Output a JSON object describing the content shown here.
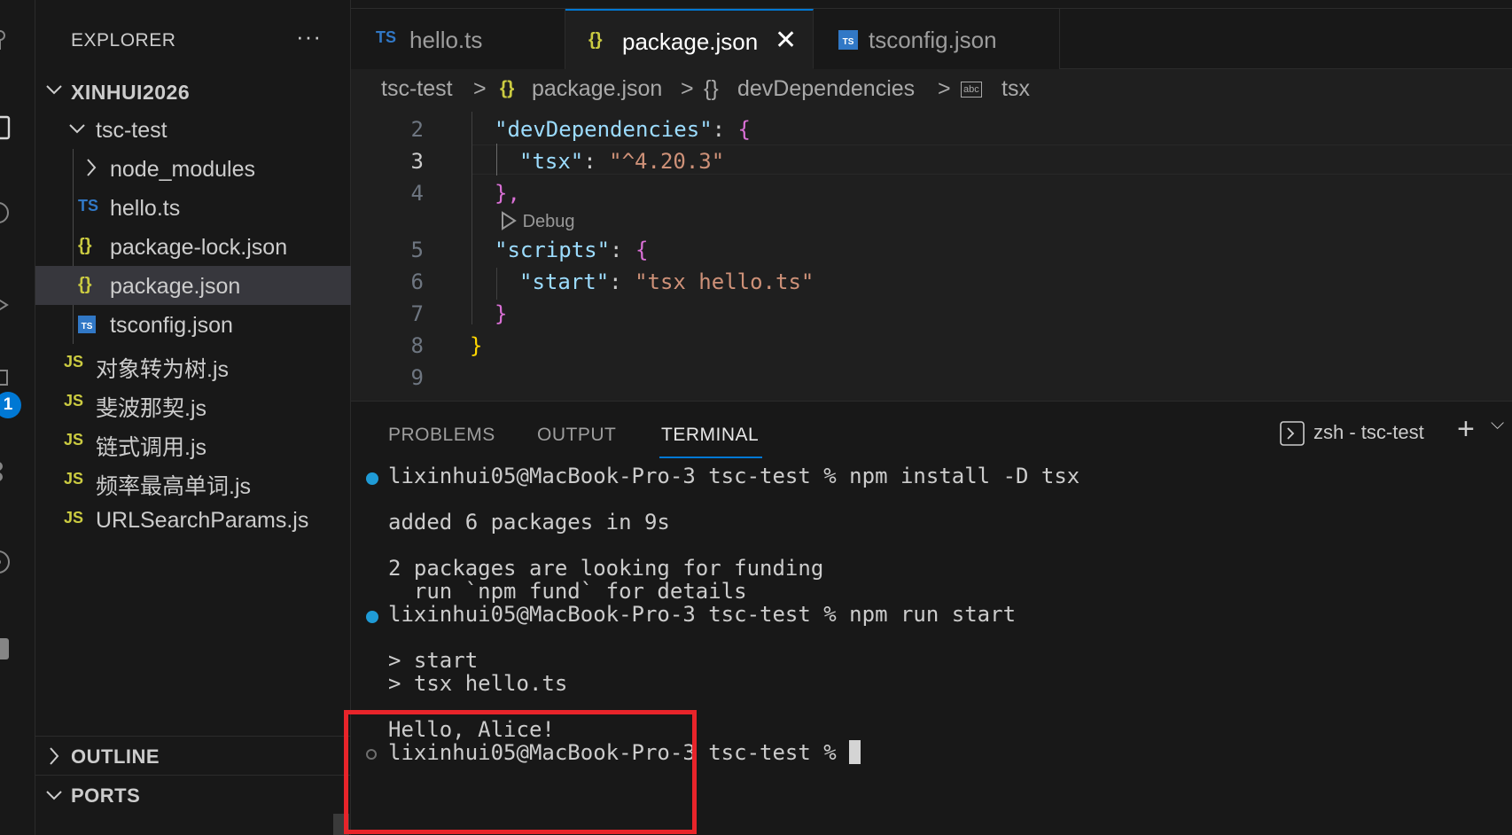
{
  "sidebar": {
    "header": "EXPLORER",
    "more": "···",
    "root": "XINHUI2026",
    "folder": "tsc-test",
    "items": [
      {
        "icon": "›",
        "label": "node_modules",
        "type": "folder"
      },
      {
        "icon": "TS",
        "label": "hello.ts",
        "type": "ts"
      },
      {
        "icon": "{}",
        "label": "package-lock.json",
        "type": "json"
      },
      {
        "icon": "{}",
        "label": "package.json",
        "type": "json"
      },
      {
        "icon": "TS",
        "label": "tsconfig.json",
        "type": "tsconfig"
      }
    ],
    "root_files": [
      {
        "icon": "JS",
        "label": "对象转为树.js"
      },
      {
        "icon": "JS",
        "label": "斐波那契.js"
      },
      {
        "icon": "JS",
        "label": "链式调用.js"
      },
      {
        "icon": "JS",
        "label": "频率最高单词.js"
      },
      {
        "icon": "JS",
        "label": "URLSearchParams.js"
      }
    ],
    "outline": "OUTLINE",
    "ports": "PORTS"
  },
  "activity_badge": "1",
  "tabs": [
    {
      "icon": "TS",
      "label": "hello.ts"
    },
    {
      "icon": "{}",
      "label": "package.json",
      "close": "✕"
    },
    {
      "icon": "TS",
      "label": "tsconfig.json"
    }
  ],
  "breadcrumb": {
    "folder": "tsc-test",
    "file_icon": "{}",
    "file": "package.json",
    "sep": ">",
    "obj_icon": "{}",
    "obj": "devDependencies",
    "leaf_icon": "abc",
    "leaf": "tsx"
  },
  "code": {
    "line_numbers": [
      "2",
      "3",
      "4",
      "5",
      "6",
      "7",
      "8",
      "9"
    ],
    "key_devdeps": "\"devDependencies\"",
    "key_tsx": "\"tsx\"",
    "val_tsx": "\"^4.20.3\"",
    "codelens": "Debug",
    "key_scripts": "\"scripts\"",
    "key_start": "\"start\"",
    "val_start": "\"tsx hello.ts\"",
    "colon": ": ",
    "open_brace": "{",
    "close_brace_comma": "},",
    "close_brace": "}"
  },
  "panel": {
    "tabs": [
      "PROBLEMS",
      "OUTPUT",
      "TERMINAL"
    ],
    "shell": "zsh - tsc-test",
    "add": "+",
    "chevron": "⌵"
  },
  "terminal": {
    "lines": [
      "lixinhui05@MacBook-Pro-3 tsc-test % npm install -D tsx",
      "added 6 packages in 9s",
      "2 packages are looking for funding",
      "  run `npm fund` for details",
      "lixinhui05@MacBook-Pro-3 tsc-test % npm run start",
      "> start",
      "> tsx hello.ts",
      "Hello, Alice!",
      "lixinhui05@MacBook-Pro-3 tsc-test % "
    ]
  },
  "colors": {
    "accent": "#0078d4",
    "highlight_box": "#e8242a",
    "ts_icon": "#3178c6",
    "js_icon": "#cbcb41",
    "json_icon": "#cbcb41"
  }
}
